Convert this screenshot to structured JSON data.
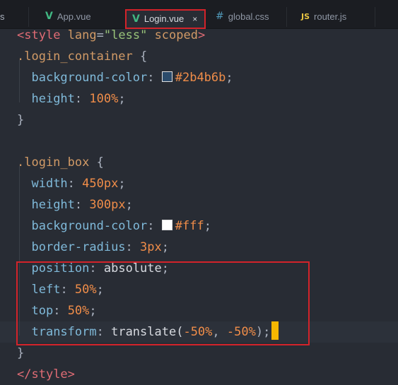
{
  "tabs": [
    {
      "icon": "vue-icon",
      "glyph": "V",
      "label": "App.vue"
    },
    {
      "icon": "vue-icon",
      "glyph": "V",
      "label": "Login.vue",
      "close": "×"
    },
    {
      "icon": "css-icon",
      "glyph": "#",
      "label": "global.css"
    },
    {
      "icon": "js-icon",
      "glyph": "JS",
      "label": "router.js"
    }
  ],
  "colors": {
    "login_container_bg": "#2b4b6b",
    "login_box_bg": "#fff",
    "highlight": "#d3232a"
  },
  "code": {
    "l1": {
      "open": "<",
      "tag": "style",
      "attr": "lang",
      "eq": "=",
      "str": "\"less\"",
      "attr2": "scoped",
      "close": ">"
    },
    "l2": {
      "selector": ".login_container",
      "brace": " {"
    },
    "l3": {
      "prop": "background-color",
      "colon": ": ",
      "value": "#2b4b6b",
      "semi": ";"
    },
    "l4": {
      "prop": "height",
      "colon": ": ",
      "num": "100",
      "unit": "%",
      "semi": ";"
    },
    "l5": {
      "brace": "}"
    },
    "l7": {
      "selector": ".login_box",
      "brace": " {"
    },
    "l8": {
      "prop": "width",
      "colon": ": ",
      "num": "450",
      "unit": "px",
      "semi": ";"
    },
    "l9": {
      "prop": "height",
      "colon": ": ",
      "num": "300",
      "unit": "px",
      "semi": ";"
    },
    "l10": {
      "prop": "background-color",
      "colon": ": ",
      "value": "#fff",
      "semi": ";"
    },
    "l11": {
      "prop": "border-radius",
      "colon": ": ",
      "num": "3",
      "unit": "px",
      "semi": ";"
    },
    "l12": {
      "prop": "position",
      "colon": ": ",
      "value": "absolute",
      "semi": ";"
    },
    "l13": {
      "prop": "left",
      "colon": ": ",
      "num": "50",
      "unit": "%",
      "semi": ";"
    },
    "l14": {
      "prop": "top",
      "colon": ": ",
      "num": "50",
      "unit": "%",
      "semi": ";"
    },
    "l15": {
      "prop": "transform",
      "colon": ": ",
      "fn": "translate(",
      "num1": "-50",
      "unit1": "%",
      "comma": ", ",
      "num2": "-50",
      "unit2": "%",
      "end": ");"
    },
    "l16": {
      "brace": "}"
    },
    "l17": {
      "open": "</",
      "tag": "style",
      "close": ">"
    }
  }
}
